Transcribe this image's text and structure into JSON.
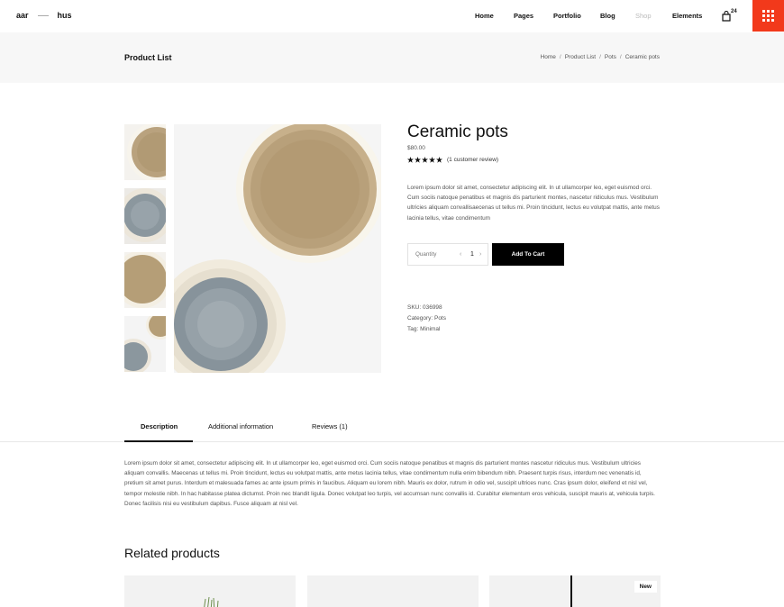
{
  "brand": {
    "part1": "aar",
    "part2": "hus"
  },
  "nav": {
    "items": [
      {
        "label": "Home"
      },
      {
        "label": "Pages"
      },
      {
        "label": "Portfolio"
      },
      {
        "label": "Blog"
      },
      {
        "label": "Shop"
      },
      {
        "label": "Elements"
      }
    ],
    "cart_count": "24"
  },
  "page": {
    "title": "Product List",
    "breadcrumb": [
      "Home",
      "Product List",
      "Pots",
      "Ceramic pots"
    ]
  },
  "product": {
    "name": "Ceramic pots",
    "price": "$80.00",
    "rating": 5,
    "review_text": "(1 customer review)",
    "description": "Lorem ipsum dolor sit amet, consectetur adipiscing elit. In ut ullamcorper leo, eget euismod orci. Cum sociis natoque penatibus et magnis dis parturient montes, nascetur ridiculus mus. Vestibulum ultricies aliquam convallisaecenas ut tellus mi. Proin tincidunt, lectus eu volutpat mattis, ante metus lacinia tellus, vitae condimentum",
    "quantity_label": "Quantity",
    "quantity_value": "1",
    "add_to_cart": "Add To Cart",
    "sku": "SKU: 036998",
    "category": "Category: Pots",
    "tag": "Tag: Minimal"
  },
  "tabs": {
    "items": [
      {
        "label": "Description"
      },
      {
        "label": "Additional information"
      },
      {
        "label": "Reviews (1)"
      }
    ],
    "active": "Description",
    "content": "Lorem ipsum dolor sit amet, consectetur adipiscing elit. In ut ullamcorper leo, eget euismod orci. Cum sociis natoque penatibus et magnis dis parturient montes nascetur ridiculus mus. Vestibulum ultricies aliquam convallis. Maecenas ut tellus mi. Proin tincidunt, lectus eu volutpat mattis, ante metus lacinia tellus, vitae condimentum nulla enim bibendum nibh. Praesent turpis risus, interdum nec venenatis id, pretium sit amet purus. Interdum et malesuada fames ac ante ipsum primis in faucibus. Aliquam eu lorem nibh. Mauris ex dolor, rutrum in odio vel, suscipit ultrices nunc. Cras ipsum dolor, eleifend et nisl vel, tempor molestie nibh. In hac habitasse platea dictumst. Proin nec blandit ligula. Donec volutpat leo turpis, vel accumsan nunc convallis id. Curabitur elementum eros vehicula, suscipit mauris at, vehicula turpis. Donec facilisis nisi eu vestibulum dapibus. Fusce aliquam at nisl vel."
  },
  "related": {
    "title": "Related products",
    "badge_new": "New"
  },
  "colors": {
    "accent": "#f2391b",
    "button": "#000000"
  },
  "icons": [
    "cart-icon",
    "grid-menu-icon",
    "star-icon",
    "chevron-left-icon",
    "chevron-right-icon"
  ]
}
